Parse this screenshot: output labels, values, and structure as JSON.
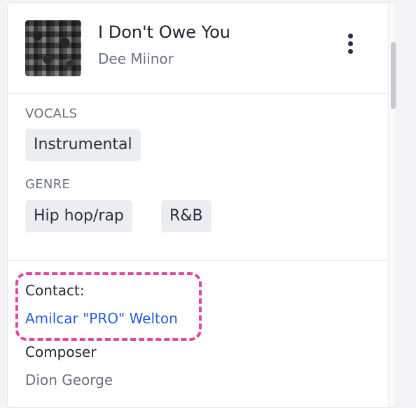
{
  "track": {
    "title": "I Don't Owe You",
    "artist": "Dee Miinor",
    "menu_icon": "more-vertical-icon"
  },
  "vocals": {
    "label": "VOCALS",
    "tags": [
      "Instrumental"
    ]
  },
  "genre": {
    "label": "GENRE",
    "tags": [
      "Hip hop/rap",
      "R&B"
    ]
  },
  "contact": {
    "label": "Contact:",
    "name": "Amilcar \"PRO\" Welton"
  },
  "composer": {
    "label": "Composer",
    "name": "Dion George"
  },
  "colors": {
    "highlight": "#e0489a",
    "link": "#1f5fd6"
  }
}
